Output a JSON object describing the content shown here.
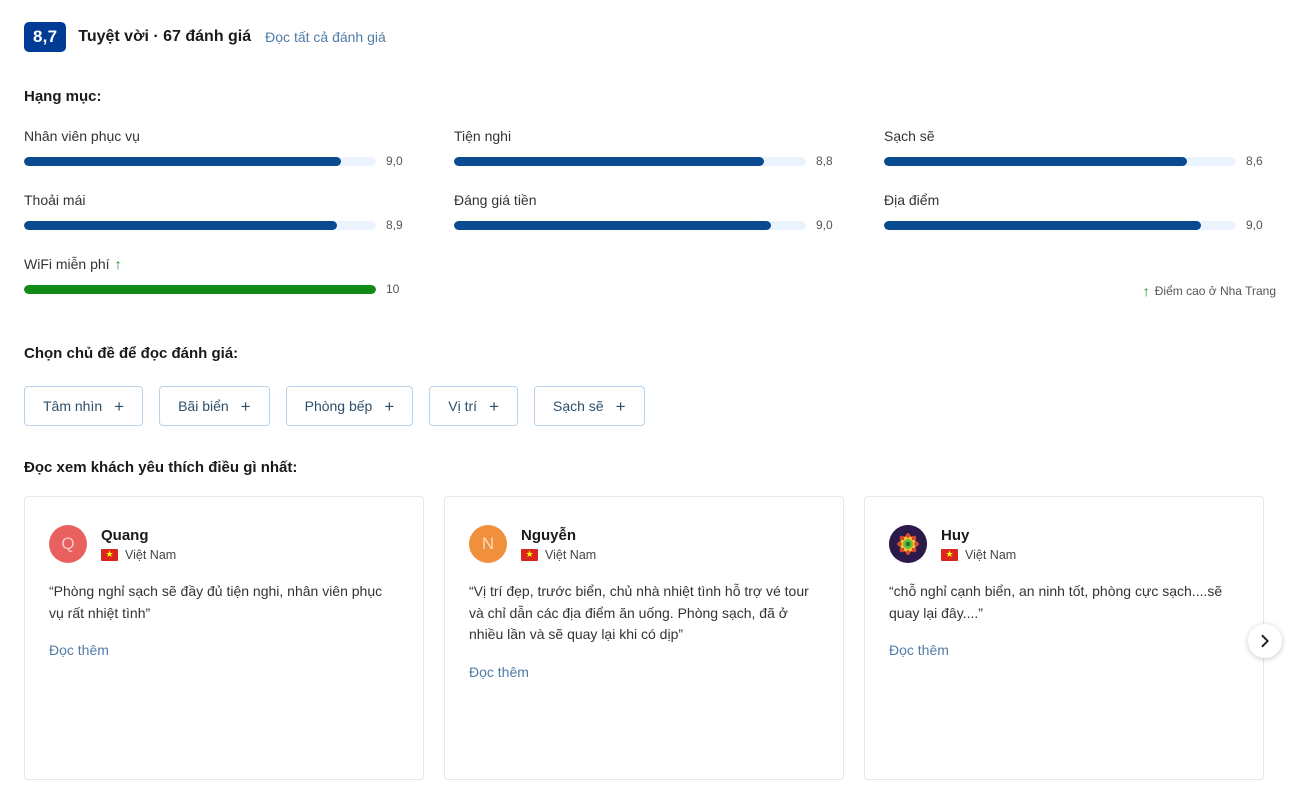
{
  "header": {
    "score": "8,7",
    "score_word": "Tuyệt vời",
    "separator": "·",
    "review_count_text": "67 đánh giá",
    "all_reviews_link": "Đọc tất cả đánh giá"
  },
  "categories_section": {
    "heading": "Hạng mục:",
    "high_score_note": "Điểm cao ở Nha Trang",
    "high_score_icon": "arrow-up-icon",
    "items": [
      {
        "label": "Nhân viên phục vụ",
        "value": "9,0",
        "percent": 90,
        "highlight": false
      },
      {
        "label": "Tiện nghi",
        "value": "8,8",
        "percent": 88,
        "highlight": false
      },
      {
        "label": "Sạch sẽ",
        "value": "8,6",
        "percent": 86,
        "highlight": false
      },
      {
        "label": "Thoải mái",
        "value": "8,9",
        "percent": 89,
        "highlight": false
      },
      {
        "label": "Đáng giá tiền",
        "value": "9,0",
        "percent": 90,
        "highlight": false
      },
      {
        "label": "Địa điểm",
        "value": "9,0",
        "percent": 90,
        "highlight": false
      },
      {
        "label": "WiFi miễn phí",
        "value": "10",
        "percent": 100,
        "highlight": true
      }
    ]
  },
  "topics_section": {
    "heading": "Chọn chủ đề để đọc đánh giá:",
    "chips": [
      {
        "label": "Tâm nhìn",
        "icon": "plus-icon",
        "plus": "+"
      },
      {
        "label": "Bãi biển",
        "icon": "plus-icon",
        "plus": "+"
      },
      {
        "label": "Phòng bếp",
        "icon": "plus-icon",
        "plus": "+"
      },
      {
        "label": "Vị trí",
        "icon": "plus-icon",
        "plus": "+"
      },
      {
        "label": "Sạch sẽ",
        "icon": "plus-icon",
        "plus": "+"
      }
    ]
  },
  "reviews_section": {
    "heading": "Đọc xem khách yêu thích điều gì nhất:",
    "next_icon": "chevron-right-icon",
    "cards": [
      {
        "name": "Quang",
        "country": "Việt Nam",
        "avatar_initial": "Q",
        "avatar_style": "red",
        "quote": "“Phòng nghỉ sạch sẽ đầy đủ tiện nghi, nhân viên phục vụ rất nhiệt tình”",
        "read_more": "Đọc thêm"
      },
      {
        "name": "Nguyễn",
        "country": "Việt Nam",
        "avatar_initial": "N",
        "avatar_style": "orange",
        "quote": "“Vị trí đẹp, trước biển, chủ nhà nhiệt tình hỗ trợ vé tour và chỉ dẫn các địa điểm ăn uống. Phòng sạch, đã ở nhiều lần và sẽ quay lại khi có dịp”",
        "read_more": "Đọc thêm"
      },
      {
        "name": "Huy",
        "country": "Việt Nam",
        "avatar_initial": "",
        "avatar_style": "photo",
        "quote": "“chỗ nghỉ cạnh biển, an ninh tốt, phòng cực sạch....sẽ quay lại đây....”",
        "read_more": "Đọc thêm"
      }
    ]
  },
  "colors": {
    "badge_navy": "#003b95",
    "bar_fill": "#0a4a8f",
    "bar_track": "#ebf3ff",
    "bar_fill_green": "#128a18",
    "link_blue": "#4f7ca6",
    "chip_border": "#b9d4ea"
  }
}
